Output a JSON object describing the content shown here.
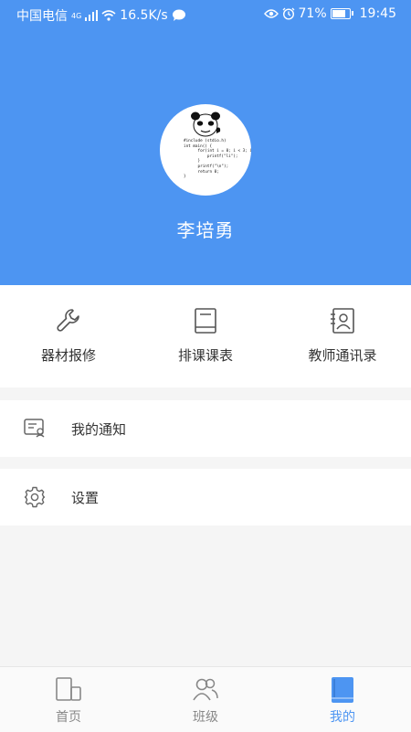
{
  "status_bar": {
    "carrier": "中国电信",
    "network": "4G",
    "speed": "16.5K/s",
    "battery": "71%",
    "time": "19:45"
  },
  "profile": {
    "name": "李培勇",
    "avatar_code": "#include (stdio.h)\nint main() {\n      for(int i = 0; i < 3; i++){\n          printf(\"li\");\n      }\n      printf(\"\\n\");\n      return 0;\n}"
  },
  "quick_actions": [
    {
      "label": "器材报修",
      "icon": "wrench-icon"
    },
    {
      "label": "排课课表",
      "icon": "notebook-icon"
    },
    {
      "label": "教师通讯录",
      "icon": "contacts-icon"
    }
  ],
  "menu": [
    {
      "label": "我的通知",
      "icon": "notification-card-icon"
    },
    {
      "label": "设置",
      "icon": "gear-icon"
    }
  ],
  "tabs": [
    {
      "label": "首页",
      "icon": "home-icon",
      "active": false
    },
    {
      "label": "班级",
      "icon": "class-icon",
      "active": false
    },
    {
      "label": "我的",
      "icon": "book-icon",
      "active": true
    }
  ],
  "colors": {
    "primary": "#4d95f2",
    "icon_gray": "#666666",
    "tab_inactive": "#888888"
  }
}
